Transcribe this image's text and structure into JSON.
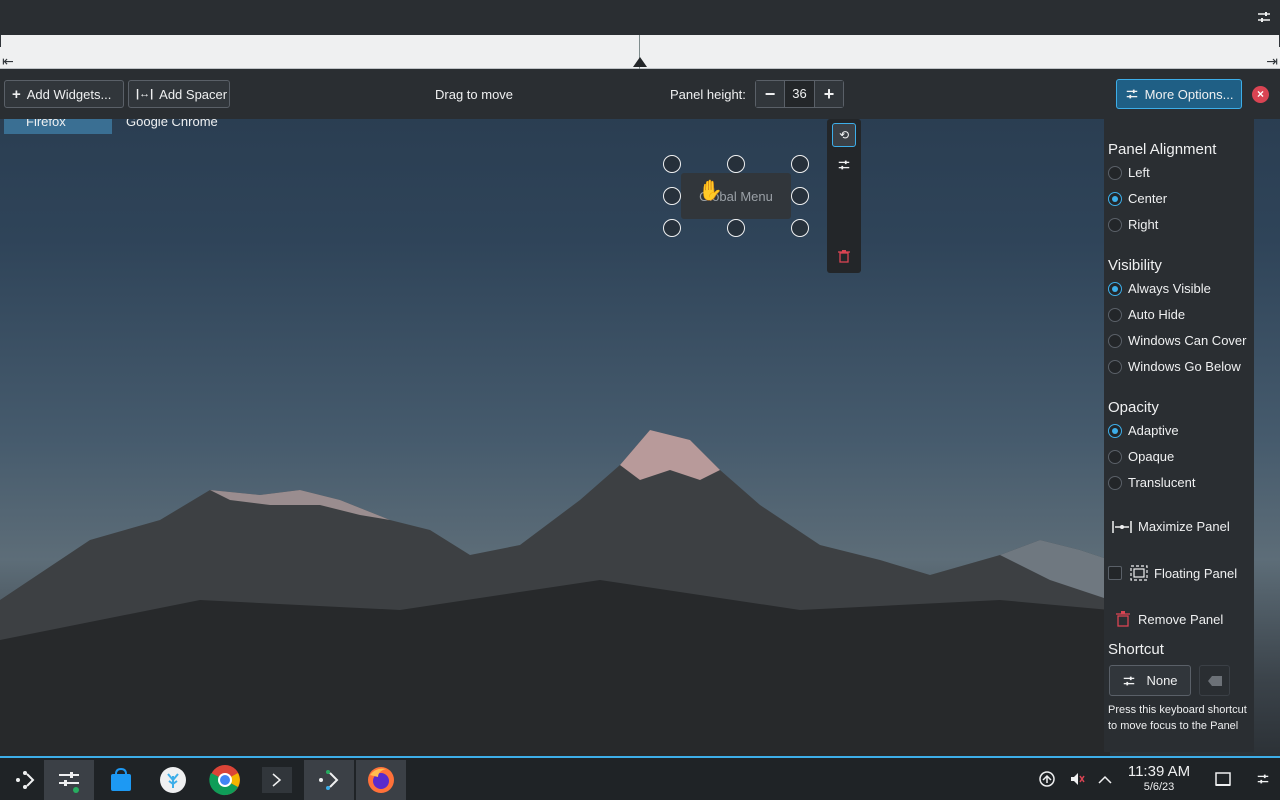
{
  "desktop": {
    "items": [
      "Firefox",
      "Google Chrome"
    ]
  },
  "panel_edit": {
    "add_widgets_label": "Add Widgets...",
    "add_spacer_label": "Add Spacer",
    "drag_label": "Drag to move",
    "panel_height_label": "Panel height:",
    "panel_height_value": "36",
    "more_options_label": "More Options...",
    "widget_label": "Global Menu"
  },
  "options": {
    "alignment_heading": "Panel Alignment",
    "alignment": [
      {
        "label": "Left",
        "checked": false
      },
      {
        "label": "Center",
        "checked": true
      },
      {
        "label": "Right",
        "checked": false
      }
    ],
    "visibility_heading": "Visibility",
    "visibility": [
      {
        "label": "Always Visible",
        "checked": true
      },
      {
        "label": "Auto Hide",
        "checked": false
      },
      {
        "label": "Windows Can Cover",
        "checked": false
      },
      {
        "label": "Windows Go Below",
        "checked": false
      }
    ],
    "opacity_heading": "Opacity",
    "opacity": [
      {
        "label": "Adaptive",
        "checked": true
      },
      {
        "label": "Opaque",
        "checked": false
      },
      {
        "label": "Translucent",
        "checked": false
      }
    ],
    "maximize_label": "Maximize Panel",
    "floating_label": "Floating Panel",
    "remove_label": "Remove Panel",
    "shortcut_heading": "Shortcut",
    "shortcut_value": "None",
    "shortcut_hint": "Press this keyboard shortcut to move focus to the Panel"
  },
  "taskbar": {
    "apps": [
      "application-launcher-icon",
      "system-settings-icon",
      "discover-store-icon",
      "kde-app-icon",
      "google-chrome-icon",
      "terminal-icon",
      "kde-connect-icon",
      "firefox-icon"
    ],
    "clock_time": "11:39 AM",
    "clock_date": "5/6/23"
  },
  "colors": {
    "accent": "#3daee9",
    "danger": "#da4453",
    "panel_bg": "#2a2e32"
  }
}
